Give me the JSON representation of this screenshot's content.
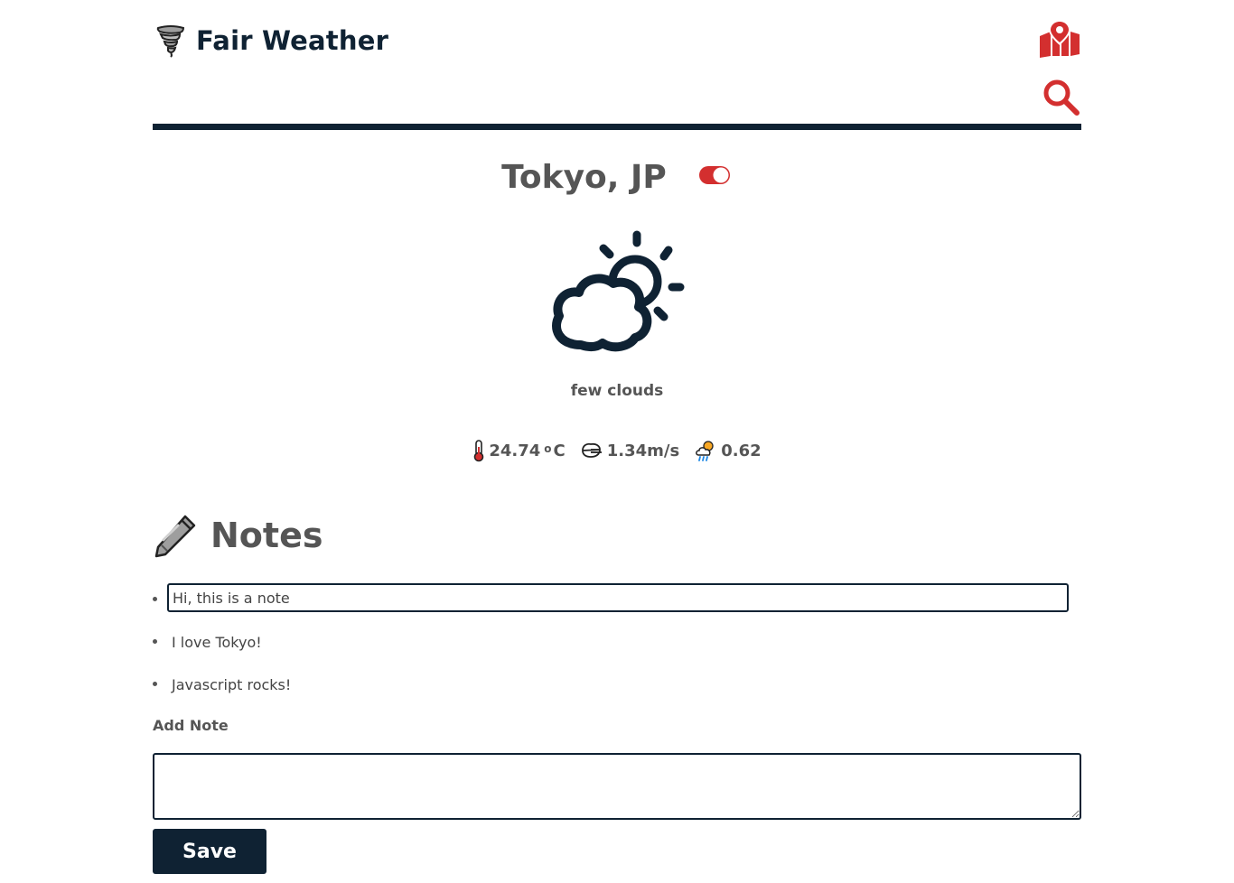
{
  "app": {
    "title": "Fair Weather",
    "brand_icon": "tornado-icon"
  },
  "header": {
    "map_icon": "map-pin-icon",
    "search_icon": "search-icon",
    "accent_color": "#d32f2f",
    "rule_color": "#0f2233"
  },
  "location": {
    "city": "Tokyo, JP",
    "favorite_toggle": "on"
  },
  "weather": {
    "icon": "cloud-sun-icon",
    "description": "few clouds",
    "temperature": "24.74",
    "temperature_unit": "o",
    "temperature_scale": "C",
    "wind": "1.34m/s",
    "rain": "0.62"
  },
  "notes": {
    "title": "Notes",
    "items": [
      {
        "text": "Hi, this is a note",
        "editing": true
      },
      {
        "text": "I love Tokyo!"
      },
      {
        "text": "Javascript rocks!"
      }
    ],
    "add_label": "Add Note",
    "add_value": "",
    "save_label": "Save"
  }
}
